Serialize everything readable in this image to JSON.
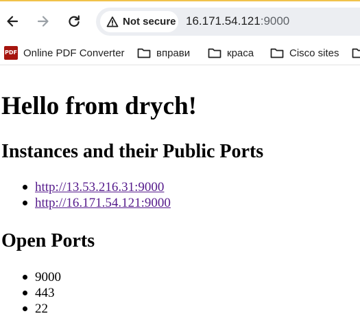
{
  "toolbar": {
    "security_chip": "Not secure",
    "url_host": "16.171.54.121",
    "url_port": ":9000",
    "icons": [
      "back-arrow-icon",
      "forward-arrow-icon",
      "reload-icon",
      "warning-icon"
    ]
  },
  "bookmarks": [
    {
      "label": "Online PDF Converter",
      "icon": "pdf-icon"
    },
    {
      "label": "вправи",
      "icon": "folder-icon"
    },
    {
      "label": "краса",
      "icon": "folder-icon"
    },
    {
      "label": "Cisco sites",
      "icon": "folder-icon"
    }
  ],
  "page": {
    "title": "Hello from drych!",
    "instances_heading": "Instances and their Public Ports",
    "instances": [
      "http://13.53.216.31:9000",
      "http://16.171.54.121:9000"
    ],
    "ports_heading": "Open Ports",
    "ports": [
      "9000",
      "443",
      "22"
    ]
  },
  "colors": {
    "visited_link": "#551a8b",
    "pdf_icon": "#a6150f",
    "omnibox_bg": "#eceef2"
  }
}
